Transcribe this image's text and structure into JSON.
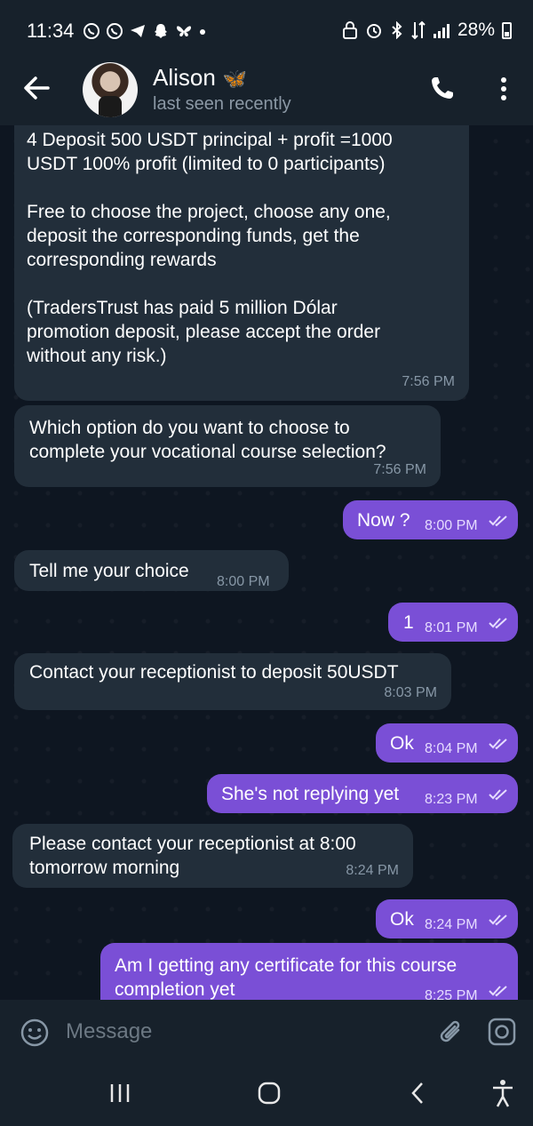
{
  "status_bar": {
    "time": "11:34",
    "battery": "28%",
    "left_icons": [
      "whatsapp-icon",
      "whatsapp-icon",
      "telegram-icon",
      "snapchat-icon",
      "bluesky-icon",
      "dot-icon"
    ],
    "right_icons": [
      "lock-icon",
      "alarm-icon",
      "bluetooth-icon",
      "data-icon",
      "signal-icon",
      "battery-icon"
    ]
  },
  "header": {
    "name": "Alison",
    "emoji": "🦋",
    "status": "last seen recently"
  },
  "messages": [
    {
      "side": "in",
      "text": "4 Deposit 500 USDT principal + profit =1000\nUSDT 100% profit (limited to 0 participants)\n\nFree to choose the project, choose any one,\ndeposit the corresponding funds, get the\ncorresponding rewards\n\n(TradersTrust has paid 5 million Dólar\npromotion deposit, please accept the order\nwithout any risk.)",
      "time": "7:56 PM"
    },
    {
      "side": "in",
      "text": "Which option do you want to choose to\ncomplete your vocational course selection?",
      "time": "7:56 PM"
    },
    {
      "side": "out",
      "text": "Now ?",
      "time": "8:00 PM"
    },
    {
      "side": "in",
      "text": "Tell me your choice",
      "time": "8:00 PM"
    },
    {
      "side": "out",
      "text": "1",
      "time": "8:01 PM"
    },
    {
      "side": "in",
      "text": "Contact your receptionist to deposit 50USDT",
      "time": "8:03 PM"
    },
    {
      "side": "out",
      "text": "Ok",
      "time": "8:04 PM"
    },
    {
      "side": "out",
      "text": "She's not replying yet",
      "time": "8:23 PM"
    },
    {
      "side": "in",
      "text": "Please contact your receptionist at 8:00\ntomorrow morning",
      "time": "8:24 PM"
    },
    {
      "side": "out",
      "text": "Ok",
      "time": "8:24 PM"
    },
    {
      "side": "out",
      "text": "Am I getting any certificate for this course\ncompletion yet",
      "time": "8:25 PM"
    }
  ],
  "composer": {
    "placeholder": "Message"
  },
  "colors": {
    "background": "#0e1621",
    "bar": "#17212b",
    "incoming": "#222e3a",
    "outgoing": "#7a4fd6"
  }
}
